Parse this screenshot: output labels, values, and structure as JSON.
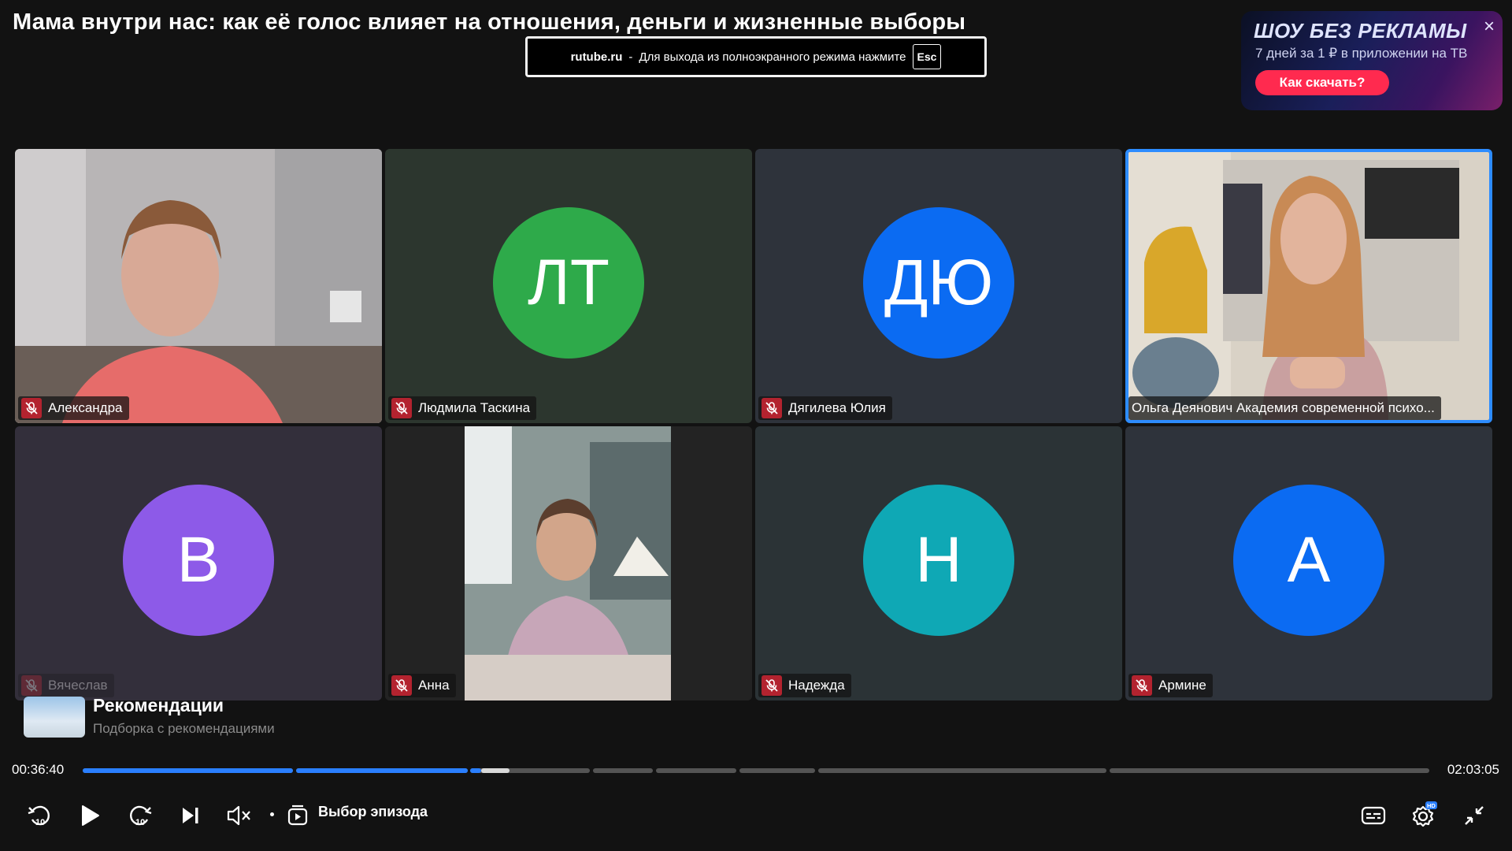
{
  "video": {
    "title": "Мама внутри нас: как её голос влияет на отношения, деньги и жизненные выборы"
  },
  "fullscreen_notice": {
    "site": "rutube.ru",
    "separator": "-",
    "message": "Для выхода из полноэкранного режима нажмите",
    "key": "Esc"
  },
  "ad": {
    "title": "ШОУ БЕЗ РЕКЛАМЫ",
    "subtitle": "7 дней за 1 ₽ в приложении на ТВ",
    "button": "Как скачать?",
    "close": "×"
  },
  "participants": [
    {
      "name": "Александра",
      "type": "video",
      "muted": true
    },
    {
      "name": "Людмила Таскина",
      "type": "avatar",
      "initials": "ЛТ",
      "color": "#2eaa4a",
      "bg": "#2c362e",
      "muted": true
    },
    {
      "name": "Дягилева Юлия",
      "type": "avatar",
      "initials": "ДЮ",
      "color": "#0b6bf2",
      "bg": "#2e333b",
      "muted": true
    },
    {
      "name": "Ольга Деянович Академия современной психо...",
      "type": "video",
      "muted": false,
      "active": true
    },
    {
      "name": "Вячеслав",
      "type": "avatar",
      "initials": "В",
      "color": "#8d5ae8",
      "bg": "#332f3b",
      "muted": true
    },
    {
      "name": "Анна",
      "type": "video",
      "muted": true
    },
    {
      "name": "Надежда",
      "type": "avatar",
      "initials": "Н",
      "color": "#0fa8b5",
      "bg": "#2b3336",
      "muted": true
    },
    {
      "name": "Армине",
      "type": "avatar",
      "initials": "А",
      "color": "#0b6bf2",
      "bg": "#2e333b",
      "muted": true
    }
  ],
  "recommendations": {
    "title": "Рекомендации",
    "subtitle": "Подборка с рекомендациями"
  },
  "player": {
    "current_time": "00:36:40",
    "total_time": "02:03:05",
    "progress_fraction": 0.298,
    "buffered_fraction": 0.32,
    "rewind_label": "10",
    "forward_label": "10",
    "episode_label": "Выбор эпизода",
    "hd_badge": "HD"
  },
  "colors": {
    "accent": "#2a7fff",
    "mic_muted": "#b3232f",
    "ad_button": "#ff2a4f"
  }
}
